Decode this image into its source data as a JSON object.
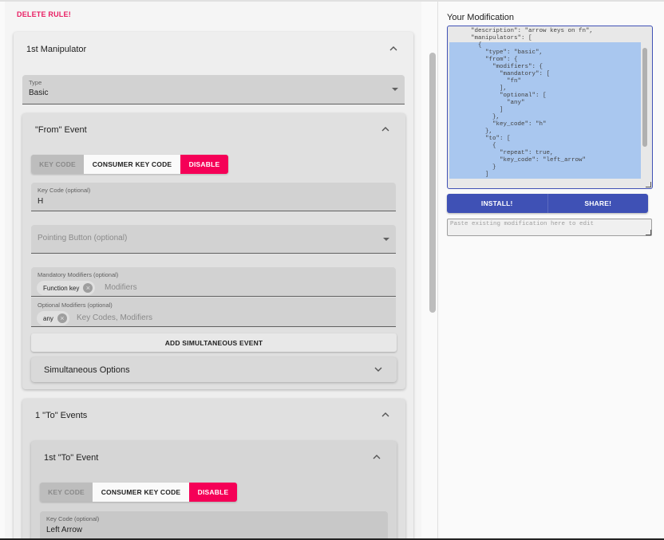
{
  "delete_rule": "DELETE RULE!",
  "manipulator": {
    "title": "1st Manipulator",
    "type_field": {
      "label": "Type",
      "value": "Basic"
    },
    "from_event": {
      "title": "\"From\" Event",
      "buttons": [
        "KEY CODE",
        "CONSUMER KEY CODE",
        "DISABLE"
      ],
      "key_code_field": {
        "label": "Key Code (optional)",
        "value": "H"
      },
      "pointing_button": {
        "placeholder": "Pointing Button (optional)"
      },
      "mandatory_modifiers": {
        "label": "Mandatory Modifiers (optional)",
        "chip": "Function key",
        "placeholder": "Modifiers"
      },
      "optional_modifiers": {
        "label": "Optional Modifiers (optional)",
        "chip": "any",
        "placeholder": "Key Codes, Modifiers"
      },
      "add_simultaneous": "ADD SIMULTANEOUS EVENT",
      "simultaneous_options": "Simultaneous Options"
    },
    "to_events": {
      "title": "1 \"To\" Events",
      "first": {
        "title": "1st \"To\" Event",
        "buttons": [
          "KEY CODE",
          "CONSUMER KEY CODE",
          "DISABLE"
        ],
        "key_code_field": {
          "label": "Key Code (optional)",
          "value": "Left Arrow"
        }
      }
    }
  },
  "modification": {
    "title": "Your Modification",
    "code_lines": [
      {
        "text": "      \"description\": \"arrow keys on fn\",",
        "selected": false
      },
      {
        "text": "      \"manipulators\": [",
        "selected": false
      },
      {
        "text": "        {",
        "selected": true
      },
      {
        "text": "          \"type\": \"basic\",",
        "selected": true
      },
      {
        "text": "          \"from\": {",
        "selected": true
      },
      {
        "text": "            \"modifiers\": {",
        "selected": true
      },
      {
        "text": "              \"mandatory\": [",
        "selected": true
      },
      {
        "text": "                \"fn\"",
        "selected": true
      },
      {
        "text": "              ],",
        "selected": true
      },
      {
        "text": "              \"optional\": [",
        "selected": true
      },
      {
        "text": "                \"any\"",
        "selected": true
      },
      {
        "text": "              ]",
        "selected": true
      },
      {
        "text": "            },",
        "selected": true
      },
      {
        "text": "            \"key_code\": \"h\"",
        "selected": true
      },
      {
        "text": "          },",
        "selected": true
      },
      {
        "text": "          \"to\": [",
        "selected": true
      },
      {
        "text": "            {",
        "selected": true
      },
      {
        "text": "              \"repeat\": true,",
        "selected": true
      },
      {
        "text": "              \"key_code\": \"left_arrow\"",
        "selected": true
      },
      {
        "text": "            }",
        "selected": true
      },
      {
        "text": "          ]",
        "selected": true
      }
    ],
    "install_label": "INSTALL!",
    "share_label": "SHARE!",
    "paste_placeholder": "Paste existing modification here to edit"
  },
  "colors": {
    "accent": "#f50057",
    "primary": "#3f51b5",
    "selection": "#a9c7ef"
  },
  "icons": [
    "chevron-up-icon",
    "dropdown-caret-icon",
    "chevron-down-icon",
    "chip-remove-icon",
    "resize-handle-icon"
  ]
}
